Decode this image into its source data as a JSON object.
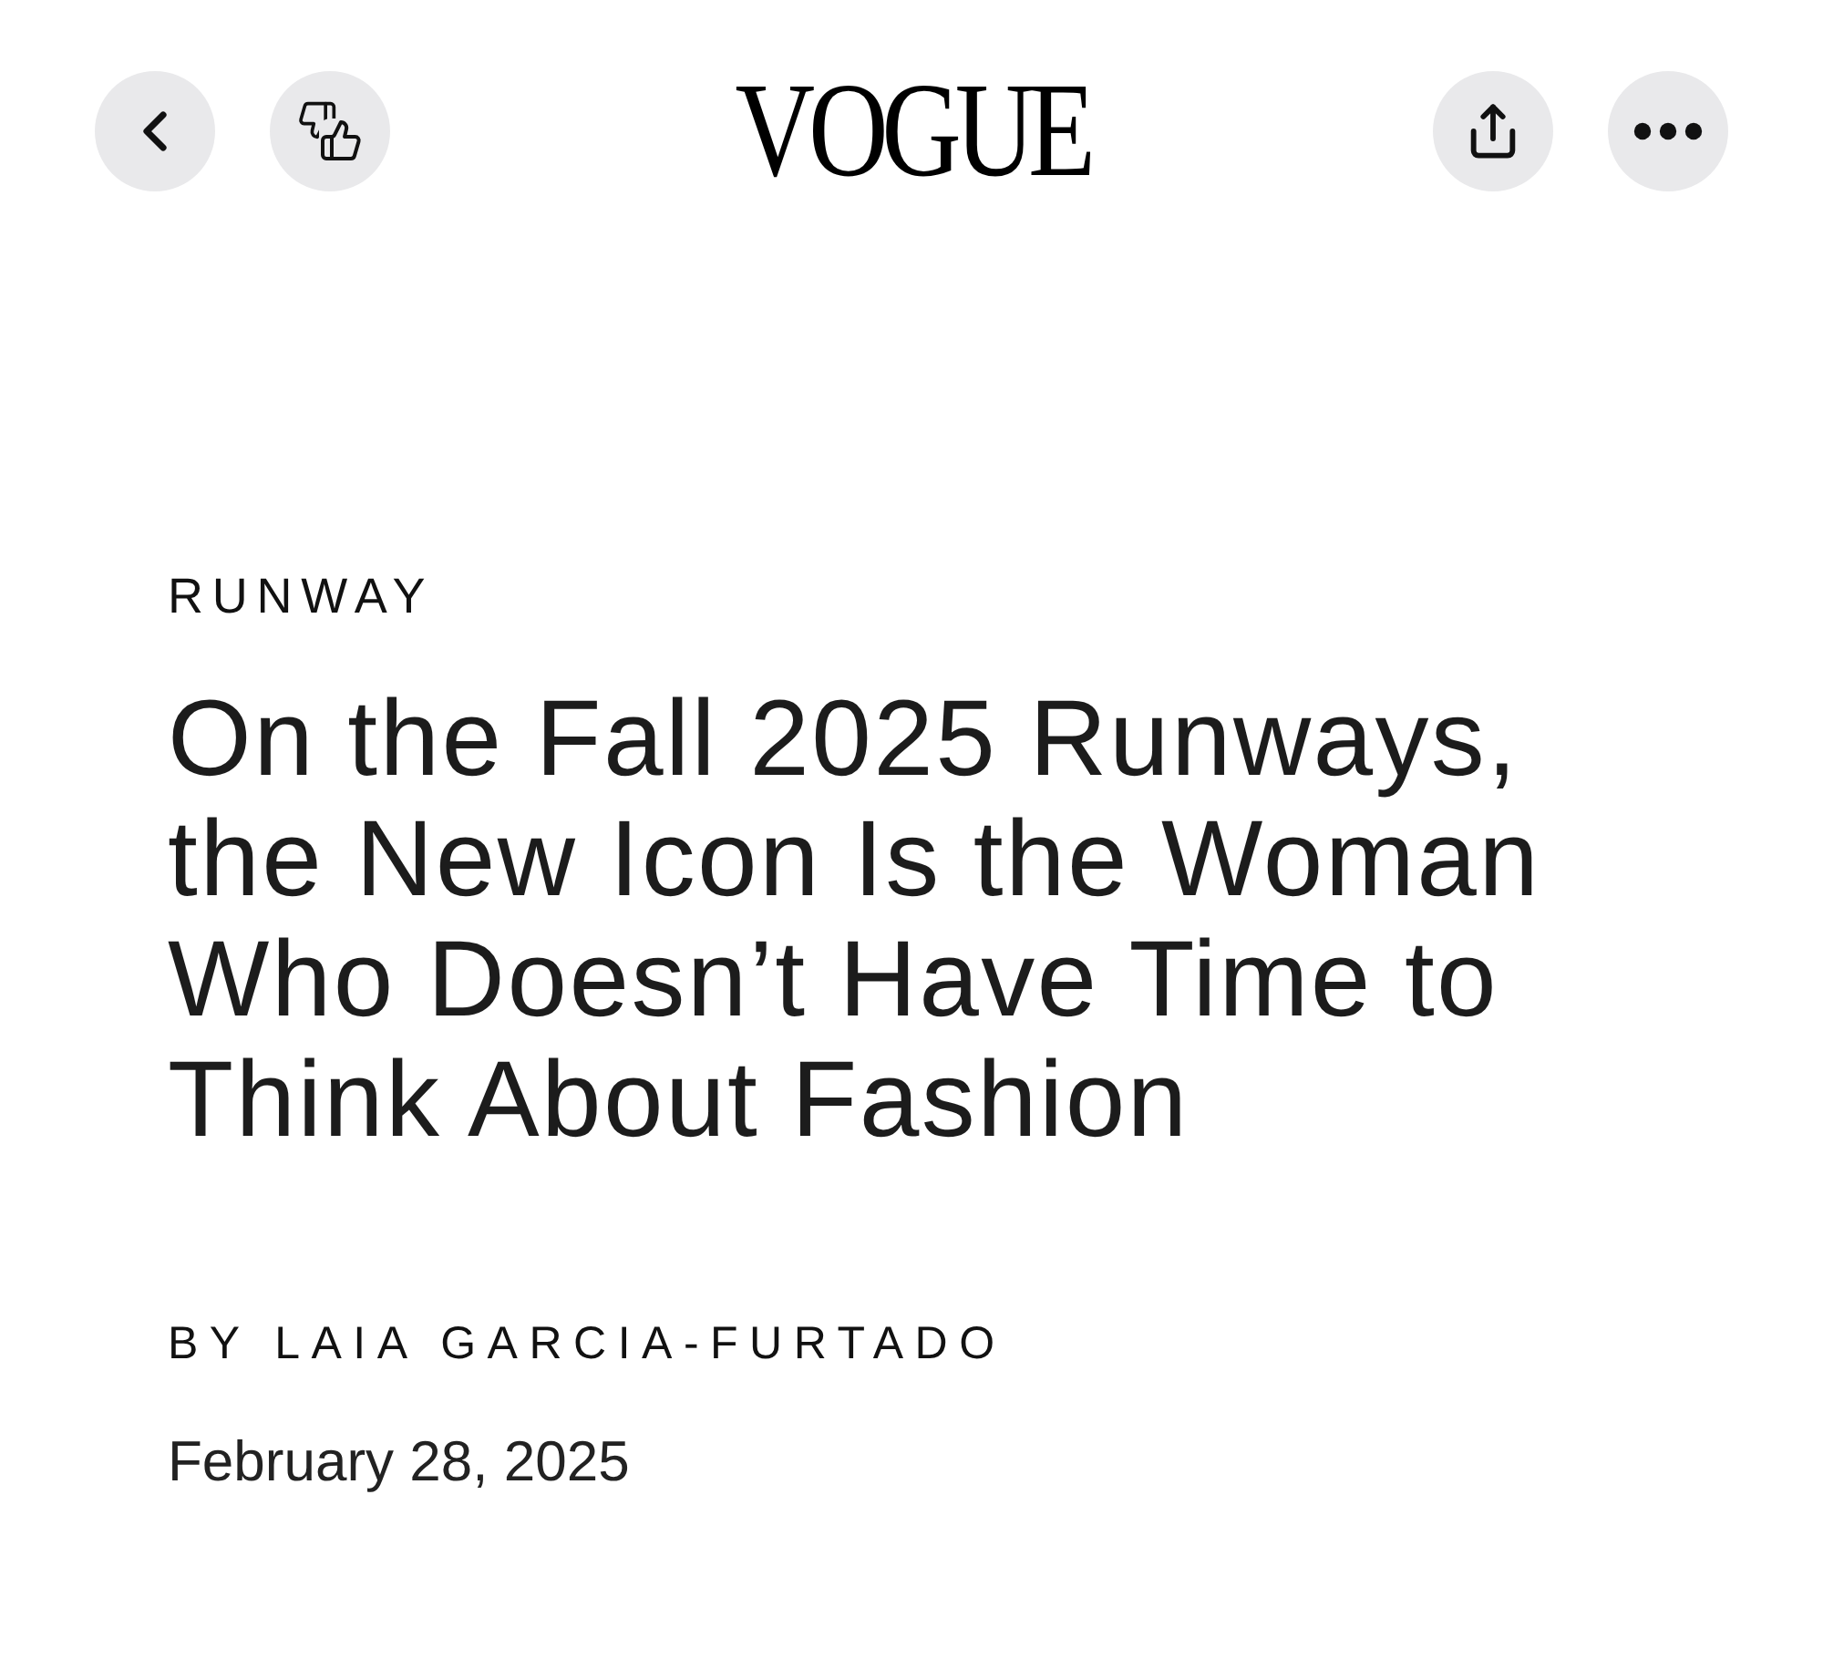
{
  "top_bar": {
    "left_buttons": [
      {
        "kind": "back"
      },
      {
        "kind": "rate"
      }
    ],
    "logo": "VOGUE",
    "right_buttons": [
      {
        "kind": "share"
      },
      {
        "kind": "more"
      }
    ]
  },
  "article": {
    "category": "RUNWAY",
    "headline": "On the Fall 2025 Runways, the New Icon Is the Woman Who Doesn’t Have Time to Think About Fashion",
    "byline": "BY LAIA GARCIA-FURTADO",
    "date": "February 28, 2025"
  }
}
